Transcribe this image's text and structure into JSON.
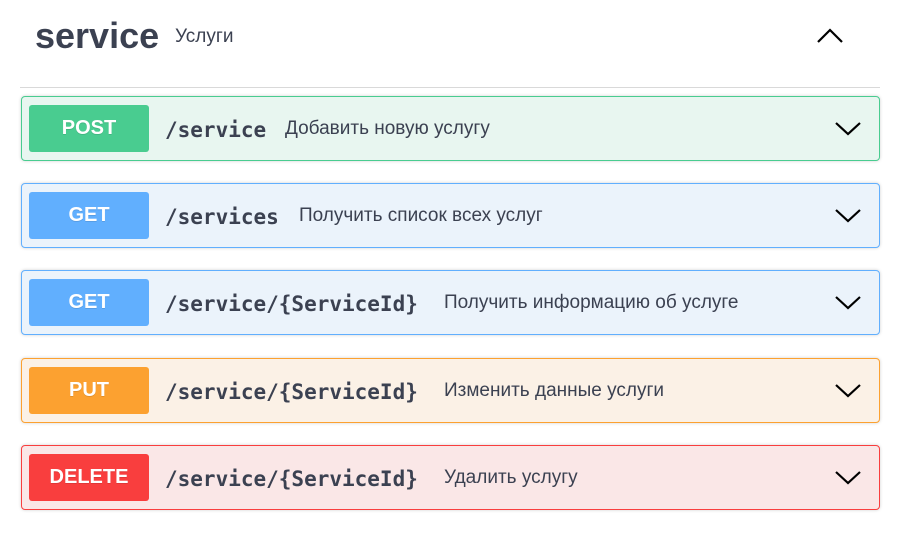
{
  "tag": {
    "name": "service",
    "description": "Услуги",
    "collapse_icon": "chevron-up-icon"
  },
  "operations": [
    {
      "method": "POST",
      "path": "/service",
      "summary": "Добавить новую услугу",
      "color": "#49cc90",
      "background": "#e8f6f0"
    },
    {
      "method": "GET",
      "path": "/services",
      "summary": "Получить список всех услуг",
      "color": "#61affe",
      "background": "#ebf3fb"
    },
    {
      "method": "GET",
      "path": "/service/{ServiceId}",
      "summary": "Получить информацию об услуге",
      "color": "#61affe",
      "background": "#ebf3fb"
    },
    {
      "method": "PUT",
      "path": "/service/{ServiceId}",
      "summary": "Изменить данные услуги",
      "color": "#fca130",
      "background": "#fbf1e6"
    },
    {
      "method": "DELETE",
      "path": "/service/{ServiceId}",
      "summary": "Удалить услугу",
      "color": "#f93e3e",
      "background": "#fae7e7"
    }
  ],
  "expand_icon": "chevron-down-icon"
}
